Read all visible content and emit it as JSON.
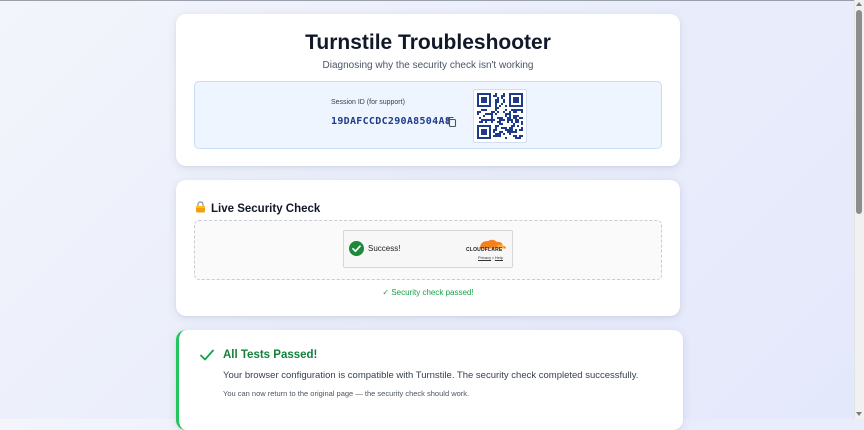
{
  "header": {
    "title": "Turnstile Troubleshooter",
    "subtitle": "Diagnosing why the security check isn't working"
  },
  "session": {
    "label": "Session ID (for support)",
    "id": "19DAFCCDC290A8504A8",
    "copy_icon": "copy-icon",
    "qr_icon": "qr-code"
  },
  "live_check": {
    "icon": "lock-icon",
    "title": "Live Security Check",
    "widget": {
      "status_text": "Success!",
      "brand": "CLOUDFLARE",
      "privacy_link": "Privacy",
      "separator": "•",
      "help_link": "Help"
    },
    "result_text": "✓ Security check passed!"
  },
  "results": {
    "icon": "checkmark-icon",
    "title": "All Tests Passed!",
    "description": "Your browser configuration is compatible with Turnstile. The security check completed successfully.",
    "note": "You can now return to the original page — the security check should work."
  },
  "colors": {
    "success": "#16a34a",
    "accent_blue": "#1e3a8a",
    "cloudflare_orange": "#f48120"
  }
}
